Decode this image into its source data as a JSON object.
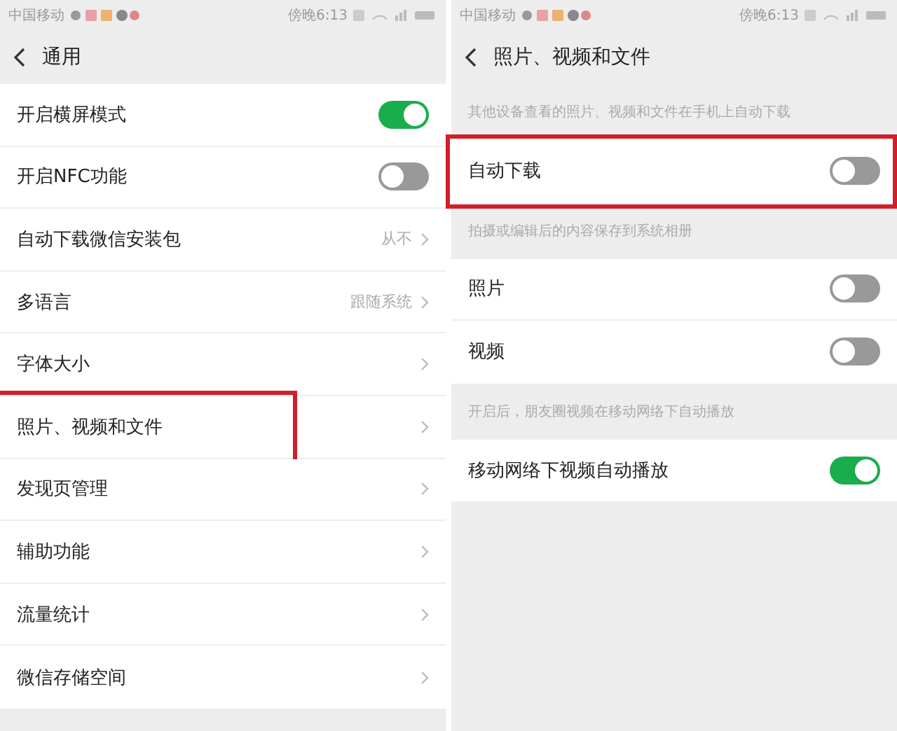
{
  "screens": [
    {
      "status_bar": {
        "carrier": "中国移动",
        "time": "傍晚6:13"
      },
      "title": "通用",
      "sections": [
        {
          "rows": [
            {
              "label": "开启横屏模式",
              "kind": "toggle",
              "on": true,
              "highlighted": false
            },
            {
              "label": "开启NFC功能",
              "kind": "toggle",
              "on": false,
              "highlighted": false
            },
            {
              "label": "自动下载微信安装包",
              "kind": "link",
              "value": "从不",
              "highlighted": false
            },
            {
              "label": "多语言",
              "kind": "link",
              "value": "跟随系统",
              "highlighted": false
            },
            {
              "label": "字体大小",
              "kind": "link",
              "highlighted": false
            },
            {
              "label": "照片、视频和文件",
              "kind": "link",
              "highlighted": true
            },
            {
              "label": "发现页管理",
              "kind": "link",
              "highlighted": false
            },
            {
              "label": "辅助功能",
              "kind": "link",
              "highlighted": false
            },
            {
              "label": "流量统计",
              "kind": "link",
              "highlighted": false
            },
            {
              "label": "微信存储空间",
              "kind": "link",
              "highlighted": false
            }
          ]
        }
      ]
    },
    {
      "status_bar": {
        "carrier": "中国移动",
        "time": "傍晚6:13"
      },
      "title": "照片、视频和文件",
      "sections": [
        {
          "caption": "其他设备查看的照片、视频和文件在手机上自动下载",
          "rows": [
            {
              "label": "自动下载",
              "kind": "toggle",
              "on": false,
              "highlighted": true
            }
          ]
        },
        {
          "caption": "拍摄或编辑后的内容保存到系统相册",
          "rows": [
            {
              "label": "照片",
              "kind": "toggle",
              "on": false,
              "highlighted": false
            },
            {
              "label": "视频",
              "kind": "toggle",
              "on": false,
              "highlighted": false
            }
          ]
        },
        {
          "caption": "开启后，朋友圈视频在移动网络下自动播放",
          "rows": [
            {
              "label": "移动网络下视频自动播放",
              "kind": "toggle",
              "on": true,
              "highlighted": false
            }
          ]
        }
      ]
    }
  ]
}
